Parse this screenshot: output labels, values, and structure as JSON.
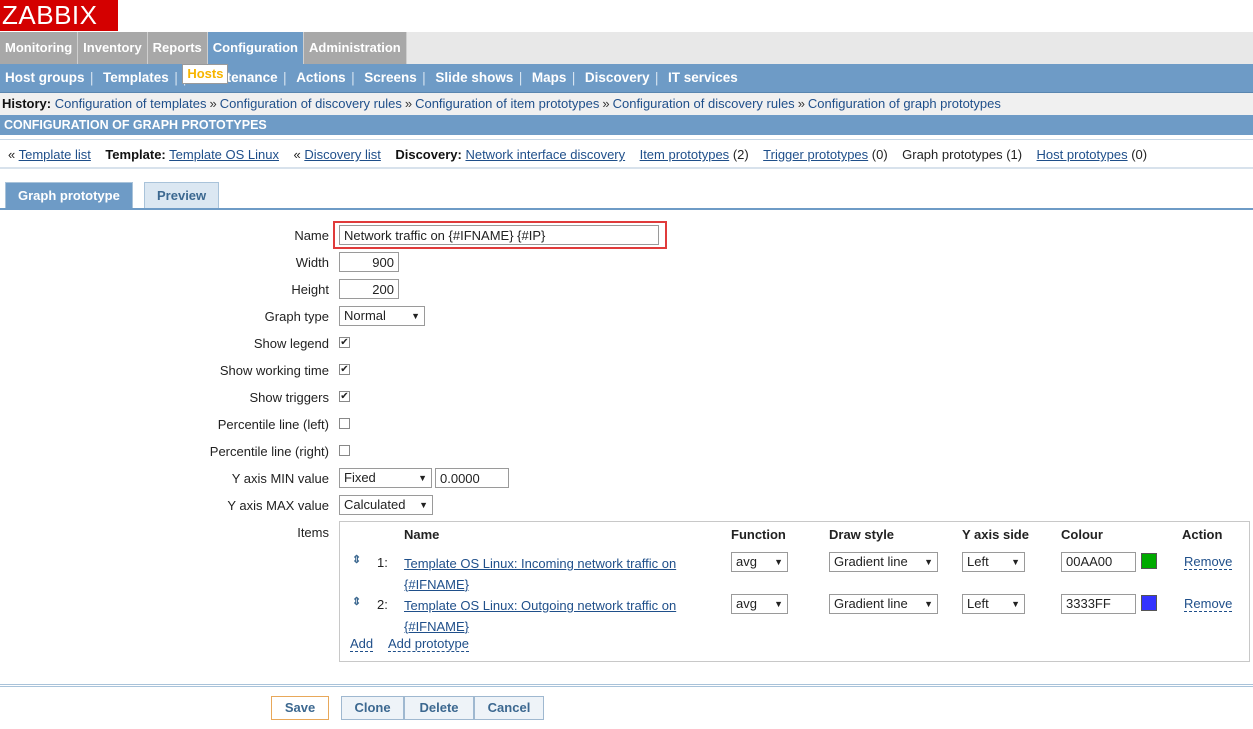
{
  "app": {
    "logo": "ZABBIX"
  },
  "main_menu": [
    {
      "label": "Monitoring",
      "active": false
    },
    {
      "label": "Inventory",
      "active": false
    },
    {
      "label": "Reports",
      "active": false
    },
    {
      "label": "Configuration",
      "active": true
    },
    {
      "label": "Administration",
      "active": false
    }
  ],
  "sub_menu": [
    {
      "label": "Host groups"
    },
    {
      "label": "Templates"
    },
    {
      "label": "Hosts",
      "selected": true
    },
    {
      "label": "Maintenance"
    },
    {
      "label": "Actions"
    },
    {
      "label": "Screens"
    },
    {
      "label": "Slide shows"
    },
    {
      "label": "Maps"
    },
    {
      "label": "Discovery"
    },
    {
      "label": "IT services"
    }
  ],
  "history": {
    "label": "History:",
    "items": [
      "Configuration of templates",
      "Configuration of discovery rules",
      "Configuration of item prototypes",
      "Configuration of discovery rules",
      "Configuration of graph prototypes"
    ],
    "separator": "»"
  },
  "page_title": "CONFIGURATION OF GRAPH PROTOTYPES",
  "crumbs": {
    "template_list": "Template list",
    "template_label": "Template:",
    "template_name": "Template OS Linux",
    "discovery_list": "Discovery list",
    "discovery_label": "Discovery:",
    "discovery_name": "Network interface discovery",
    "item_prototypes": "Item prototypes",
    "item_prototypes_count": "(2)",
    "trigger_prototypes": "Trigger prototypes",
    "trigger_prototypes_count": "(0)",
    "graph_prototypes": "Graph prototypes (1)",
    "host_prototypes": "Host prototypes",
    "host_prototypes_count": "(0)",
    "back_mark": "«"
  },
  "tabs": [
    {
      "label": "Graph prototype",
      "active": true
    },
    {
      "label": "Preview",
      "active": false
    }
  ],
  "form": {
    "name_label": "Name",
    "name_value": "Network traffic on {#IFNAME} {#IP}",
    "width_label": "Width",
    "width_value": "900",
    "height_label": "Height",
    "height_value": "200",
    "graph_type_label": "Graph type",
    "graph_type_value": "Normal",
    "show_legend_label": "Show legend",
    "show_legend": true,
    "show_working_time_label": "Show working time",
    "show_working_time": true,
    "show_triggers_label": "Show triggers",
    "show_triggers": true,
    "percentile_left_label": "Percentile line (left)",
    "percentile_left": false,
    "percentile_right_label": "Percentile line (right)",
    "percentile_right": false,
    "y_min_label": "Y axis MIN value",
    "y_min_type": "Fixed",
    "y_min_value": "0.0000",
    "y_max_label": "Y axis MAX value",
    "y_max_type": "Calculated",
    "items_label": "Items"
  },
  "items_table": {
    "headers": {
      "name": "Name",
      "function": "Function",
      "draw_style": "Draw style",
      "y_axis_side": "Y axis side",
      "colour": "Colour",
      "action": "Action"
    },
    "rows": [
      {
        "num": "1:",
        "name": "Template OS Linux: Incoming network traffic on {#IFNAME}",
        "function": "avg",
        "draw_style": "Gradient line",
        "y_axis_side": "Left",
        "colour": "00AA00",
        "swatch": "#00AA00",
        "action": "Remove"
      },
      {
        "num": "2:",
        "name": "Template OS Linux: Outgoing network traffic on {#IFNAME}",
        "function": "avg",
        "draw_style": "Gradient line",
        "y_axis_side": "Left",
        "colour": "3333FF",
        "swatch": "#3333FF",
        "action": "Remove"
      }
    ],
    "add": "Add",
    "add_prototype": "Add prototype"
  },
  "buttons": {
    "save": "Save",
    "clone": "Clone",
    "delete": "Delete",
    "cancel": "Cancel"
  },
  "icons": {
    "drag": "drag-handle-icon",
    "caret": "chevron-down-icon",
    "check": "checkmark-icon"
  }
}
